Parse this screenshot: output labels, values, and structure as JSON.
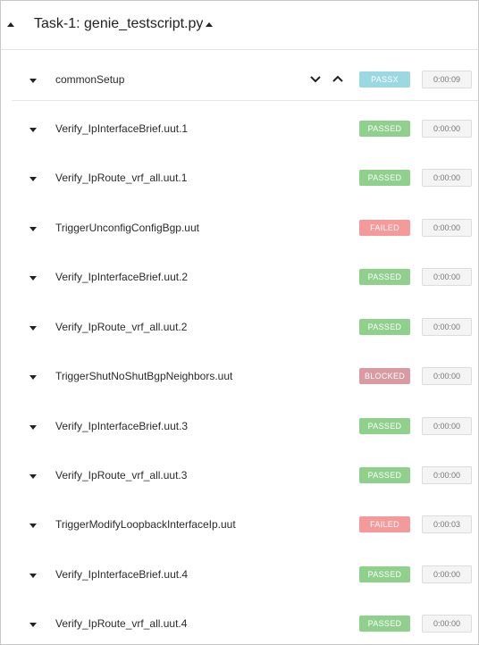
{
  "task": {
    "title": "Task-1: genie_testscript.py"
  },
  "colors": {
    "passx": "#9ad9e2",
    "passed": "#8fd08d",
    "failed": "#f59a9a",
    "blocked": "#d99aa2"
  },
  "rows": [
    {
      "label": "commonSetup",
      "status": "PASSX",
      "status_key": "passx",
      "duration": "0:00:09"
    },
    {
      "label": "Verify_IpInterfaceBrief.uut.1",
      "status": "PASSED",
      "status_key": "passed",
      "duration": "0:00:00"
    },
    {
      "label": "Verify_IpRoute_vrf_all.uut.1",
      "status": "PASSED",
      "status_key": "passed",
      "duration": "0:00:00"
    },
    {
      "label": "TriggerUnconfigConfigBgp.uut",
      "status": "FAILED",
      "status_key": "failed",
      "duration": "0:00:00"
    },
    {
      "label": "Verify_IpInterfaceBrief.uut.2",
      "status": "PASSED",
      "status_key": "passed",
      "duration": "0:00:00"
    },
    {
      "label": "Verify_IpRoute_vrf_all.uut.2",
      "status": "PASSED",
      "status_key": "passed",
      "duration": "0:00:00"
    },
    {
      "label": "TriggerShutNoShutBgpNeighbors.uut",
      "status": "BLOCKED",
      "status_key": "blocked",
      "duration": "0:00:00"
    },
    {
      "label": "Verify_IpInterfaceBrief.uut.3",
      "status": "PASSED",
      "status_key": "passed",
      "duration": "0:00:00"
    },
    {
      "label": "Verify_IpRoute_vrf_all.uut.3",
      "status": "PASSED",
      "status_key": "passed",
      "duration": "0:00:00"
    },
    {
      "label": "TriggerModifyLoopbackInterfaceIp.uut",
      "status": "FAILED",
      "status_key": "failed",
      "duration": "0:00:03"
    },
    {
      "label": "Verify_IpInterfaceBrief.uut.4",
      "status": "PASSED",
      "status_key": "passed",
      "duration": "0:00:00"
    },
    {
      "label": "Verify_IpRoute_vrf_all.uut.4",
      "status": "PASSED",
      "status_key": "passed",
      "duration": "0:00:00"
    }
  ],
  "icons": {
    "row_toggle": "caret-down-icon",
    "task_toggle": "caret-up-icon",
    "expand_all": "chevron-down-icon",
    "collapse_all": "chevron-up-icon"
  }
}
